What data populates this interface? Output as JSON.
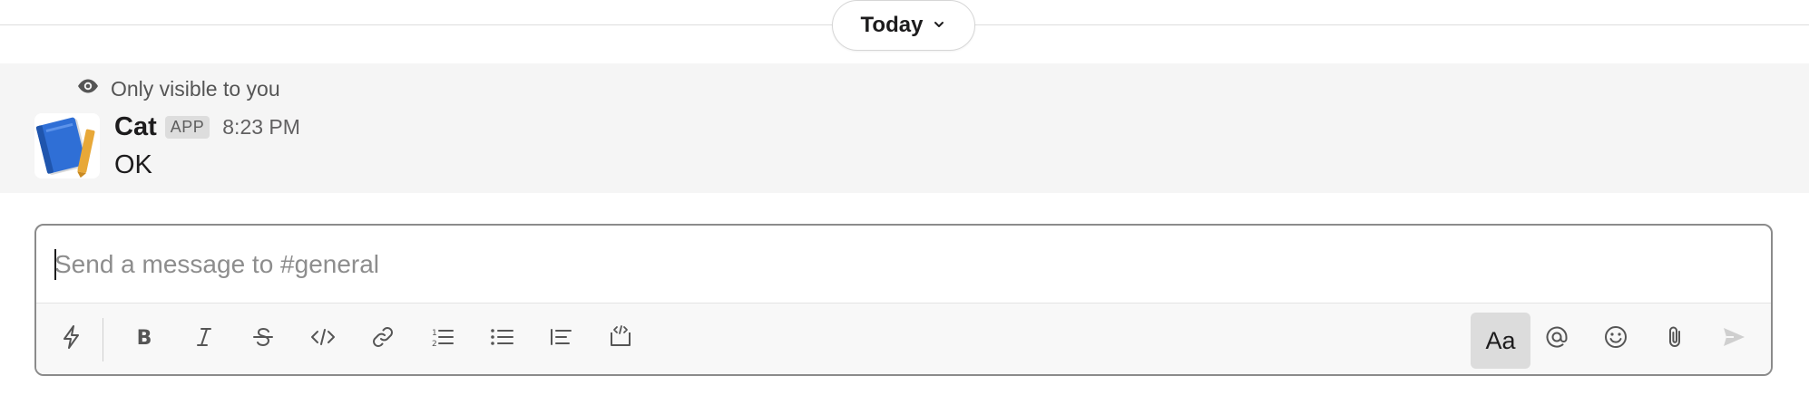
{
  "divider": {
    "date_label": "Today"
  },
  "message": {
    "visibility_note": "Only visible to you",
    "sender": "Cat",
    "badge": "APP",
    "time": "8:23 PM",
    "text": "OK"
  },
  "composer": {
    "placeholder": "Send a message to #general",
    "value": "",
    "format_toggle_label": "Aa"
  },
  "icons": {
    "shortcuts": "lightning-icon",
    "bold": "bold-icon",
    "italic": "italic-icon",
    "strikethrough": "strikethrough-icon",
    "code": "code-icon",
    "link": "link-icon",
    "ordered_list": "ordered-list-icon",
    "bulleted_list": "bulleted-list-icon",
    "blockquote": "blockquote-icon",
    "code_block": "code-block-icon",
    "mention": "at-icon",
    "emoji": "emoji-icon",
    "attach": "paperclip-icon",
    "send": "send-icon",
    "visibility": "eye-icon",
    "date_dropdown": "chevron-down-icon"
  },
  "colors": {
    "message_bg": "#f5f5f5",
    "toolbar_bg": "#f8f8f8",
    "avatar_book": "#2f6fd6",
    "avatar_pencil": "#e8a838"
  }
}
